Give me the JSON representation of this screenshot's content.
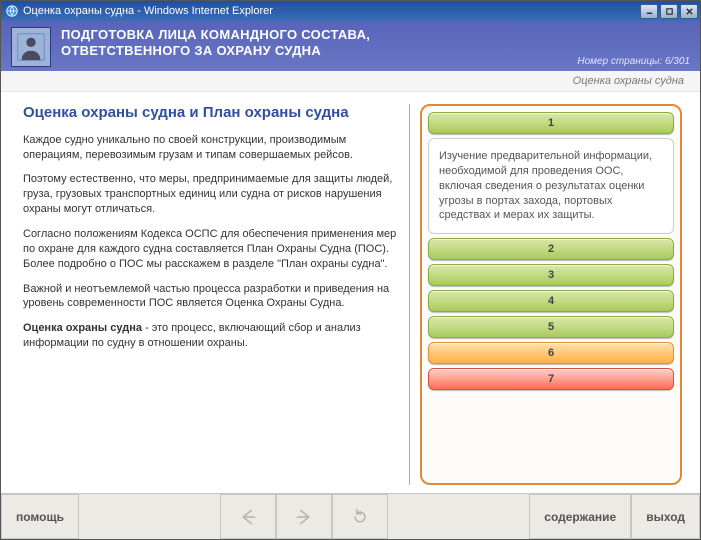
{
  "window": {
    "title": "Оценка охраны судна - Windows Internet Explorer"
  },
  "header": {
    "line1": "ПОДГОТОВКА ЛИЦА КОМАНДНОГО СОСТАВА,",
    "line2": "ОТВЕТСТВЕННОГО ЗА ОХРАНУ СУДНА",
    "page_counter": "Номер страницы: 6/301"
  },
  "breadcrumb": "Оценка охраны судна",
  "main": {
    "heading": "Оценка охраны судна и План охраны судна",
    "p1": "Каждое судно уникально по своей конструкции, производимым операциям, перевозимым грузам и типам совершаемых рейсов.",
    "p2": "Поэтому естественно, что меры, предпринимаемые для защиты людей, груза, грузовых транспортных единиц или судна от рисков нарушения охраны могут отличаться.",
    "p3": "Согласно положениям Кодекса ОСПС для обеспечения применения мер по охране для каждого судна составляется План Охраны Судна (ПОС). Более подробно о ПОС мы расскажем в разделе \"План охраны судна\".",
    "p4": "Важной и неотъемлемой частью процесса разработки и приведения на уровень современности ПОС является Оценка Охраны Судна.",
    "p5_strong": "Оценка охраны судна",
    "p5_rest": " - это процесс, включающий сбор и анализ информации по судну в отношении охраны."
  },
  "accordion": {
    "items": [
      {
        "num": "1",
        "body": "Изучение предварительной информации, необходимой для проведения ООС, включая сведения о результатах оценки угрозы в портах захода, портовых средствах и мерах их защиты."
      },
      {
        "num": "2"
      },
      {
        "num": "3"
      },
      {
        "num": "4"
      },
      {
        "num": "5"
      },
      {
        "num": "6"
      },
      {
        "num": "7"
      }
    ]
  },
  "footer": {
    "help": "помощь",
    "contents": "содержание",
    "exit": "выход"
  }
}
